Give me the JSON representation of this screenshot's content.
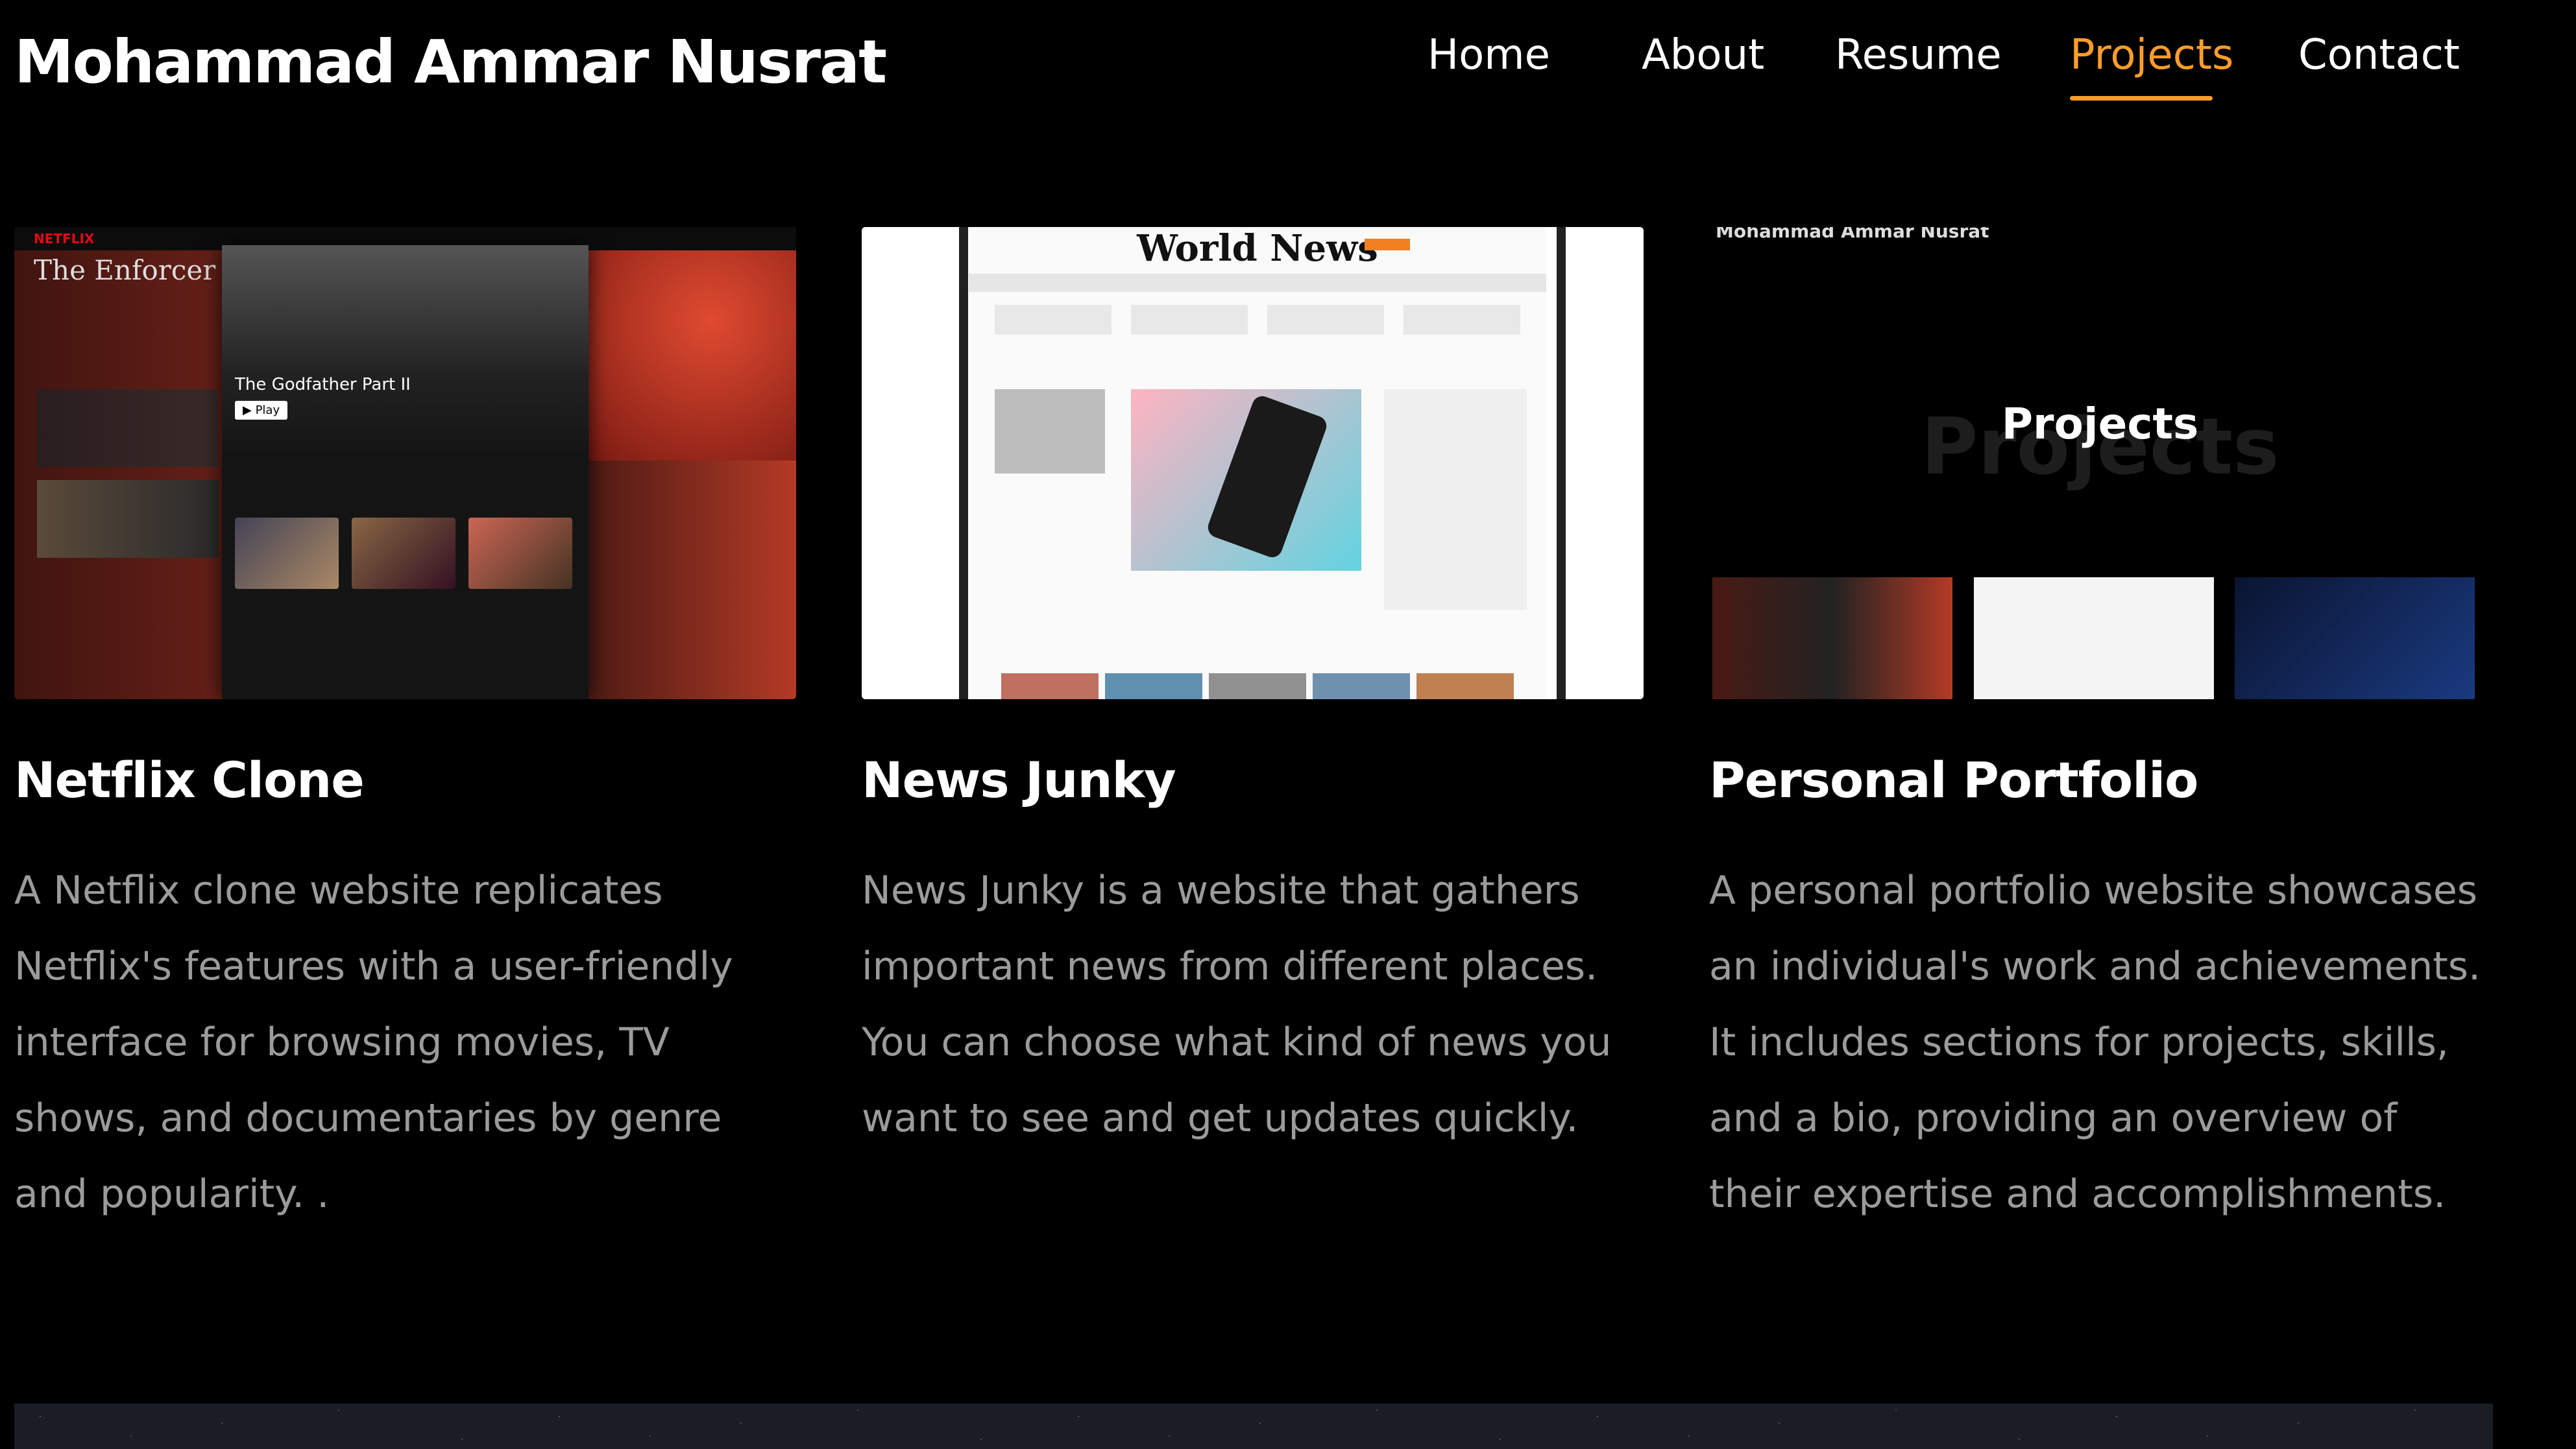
{
  "header": {
    "brand": "Mohammad Ammar Nusrat",
    "nav": [
      {
        "label": "Home",
        "active": false
      },
      {
        "label": "About",
        "active": false
      },
      {
        "label": "Resume",
        "active": false
      },
      {
        "label": "Projects",
        "active": true
      },
      {
        "label": "Contact",
        "active": false
      }
    ],
    "accent_color": "#ff9d2c"
  },
  "projects": [
    {
      "title": "Netflix Clone",
      "description": "A Netflix clone website replicates Netflix's features with a user-friendly interface for browsing movies, TV shows, and documentaries by genre and popularity. .",
      "thumb": {
        "logo": "NETFLIX",
        "hero_text": "The Enforcer",
        "modal_title": "The Godfather Part II",
        "play_label": "▶ Play"
      }
    },
    {
      "title": "News Junky",
      "description": "News Junky is a website that gathers important news from different places. You can choose what kind of news you want to see and get updates quickly.",
      "thumb": {
        "masthead": "World News"
      }
    },
    {
      "title": "Personal Portfolio",
      "description": "A personal portfolio website showcases an individual's work and achievements. It includes sections for projects, skills, and a bio, providing an overview of their expertise and accomplishments.",
      "thumb": {
        "site_name": "Mohammad Ammar Nusrat",
        "heading": "Projects",
        "heading_shadow": "Projects"
      }
    }
  ]
}
